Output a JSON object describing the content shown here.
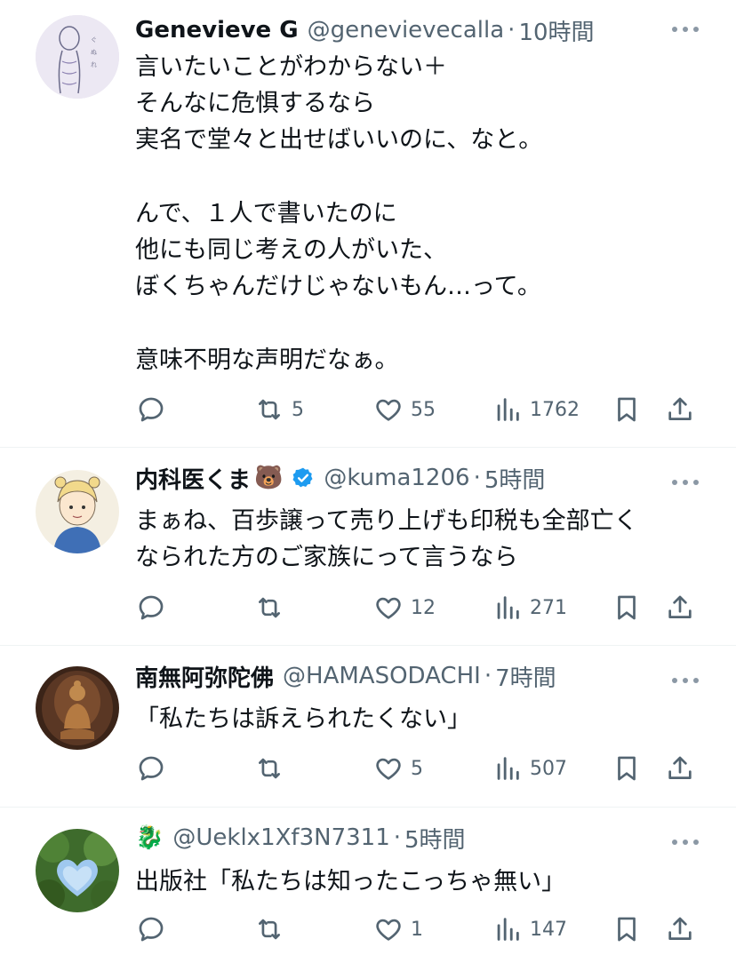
{
  "tweets": [
    {
      "name": "Genevieve G",
      "handle": "@genevievecalla",
      "dot": "·",
      "time": "10時間",
      "text": "言いたいことがわからない＋\nそんなに危惧するなら\n実名で堂々と出せばいいのに、なと。\n\nんで、１人で書いたのに\n他にも同じ考えの人がいた、\nぼくちゃんだけじゃないもん…って。\n\n意味不明な声明だなぁ。",
      "replies": "",
      "retweets": "5",
      "likes": "55",
      "views": "1762"
    },
    {
      "name": "内科医くま",
      "emoji": "🐻",
      "verified": true,
      "handle": "@kuma1206",
      "dot": "·",
      "time": "5時間",
      "text": "まぁね、百歩譲って売り上げも印税も全部亡く\nなられた方のご家族にって言うなら",
      "replies": "",
      "retweets": "",
      "likes": "12",
      "views": "271"
    },
    {
      "name": "南無阿弥陀佛",
      "handle": "@HAMASODACHI",
      "dot": "·",
      "time": "7時間",
      "text": "「私たちは訴えられたくない」",
      "replies": "",
      "retweets": "",
      "likes": "5",
      "views": "507"
    },
    {
      "name": "",
      "emoji": "🐉",
      "handle": "@Ueklx1Xf3N7311",
      "dot": "·",
      "time": "5時間",
      "text": "出版社「私たちは知ったこっちゃ無い」",
      "replies": "",
      "retweets": "",
      "likes": "1",
      "views": "147"
    }
  ],
  "icons": {
    "reply": "reply-icon",
    "retweet": "retweet-icon",
    "like": "like-icon",
    "views": "views-icon",
    "bookmark": "bookmark-icon",
    "share": "share-icon",
    "more": "more-icon",
    "verified": "verified-badge-icon"
  },
  "colors": {
    "text": "#0f1419",
    "secondary": "#536471",
    "divider": "#eff3f4",
    "verified": "#1d9bf0"
  }
}
